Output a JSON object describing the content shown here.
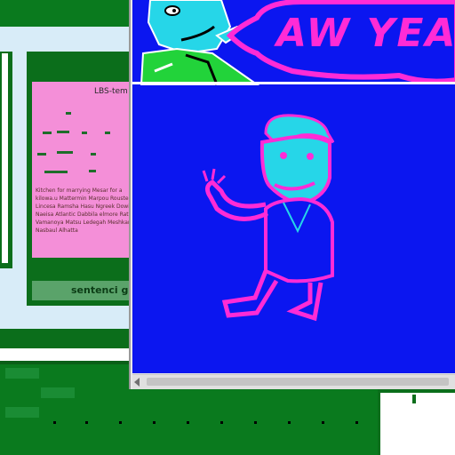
{
  "background_window": {
    "card_title": "LBS-tem",
    "card_body": "Kitchen for marrying Mesar for a kilowa.u Mattermin Marpou Rousted Lincesa Ramsha Hasu Ngreek Dowisai Naeisa Atlantic Dabbila elmore Rata Vamanoya Matsu Ledegah Meshkan Nasbaul Alhatta",
    "footer_label": "sentenci g"
  },
  "viewer": {
    "meme_text": "AW YEA"
  },
  "colors": {
    "canvas_blue": "#0b16f0",
    "magenta": "#ff2bd6",
    "cyan": "#26d6e8",
    "desktop_green": "#0a7a1e",
    "pink_card": "#f48fd8"
  },
  "icons": {
    "scroll_left": "triangle-left-icon"
  }
}
